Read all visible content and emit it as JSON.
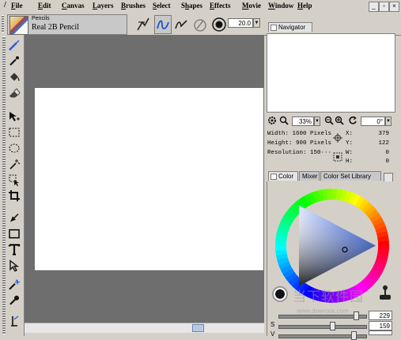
{
  "menu": {
    "items": [
      "File",
      "Edit",
      "Canvas",
      "Layers",
      "Brushes",
      "Select",
      "Shapes",
      "Effects",
      "Movie",
      "Window",
      "Help"
    ],
    "underline_index": [
      0,
      0,
      0,
      0,
      0,
      0,
      1,
      0,
      0,
      0,
      0
    ]
  },
  "toolbar": {
    "brush_category": "Pencils",
    "brush_variant": "Real 2B Pencil",
    "size_value": "20.0"
  },
  "navigator": {
    "tab_label": "Navigator",
    "zoom_value": "33%",
    "rotation_value": "0°",
    "width_text": "Width: 1600 Pixels",
    "height_text": "Height: 900 Pixels",
    "resolution_text": "Resolution: 150···",
    "x_label": "X:",
    "x_value": "379",
    "y_label": "Y:",
    "y_value": "122",
    "w_label": "W:",
    "w_value": "0",
    "h_label": "H:",
    "h_value": "0"
  },
  "color": {
    "tabs": [
      "Color",
      "Mixer",
      "Color Set Library"
    ],
    "active_tab": "Color",
    "hue_color": "#1b4fe0",
    "sliders": [
      {
        "label": "",
        "value": "229",
        "fraction": 0.9
      },
      {
        "label": "S",
        "value": "159",
        "fraction": 0.62
      },
      {
        "label": "V",
        "value": "",
        "fraction": 0.88
      }
    ]
  },
  "watermark": {
    "text": "当下软件园",
    "url": "www.downxia.com"
  },
  "colors": {
    "chrome": "#d4d0c8",
    "workspace": "#6e6e6e",
    "paper": "#ffffff",
    "tool_blue": "#2a5bd7"
  }
}
